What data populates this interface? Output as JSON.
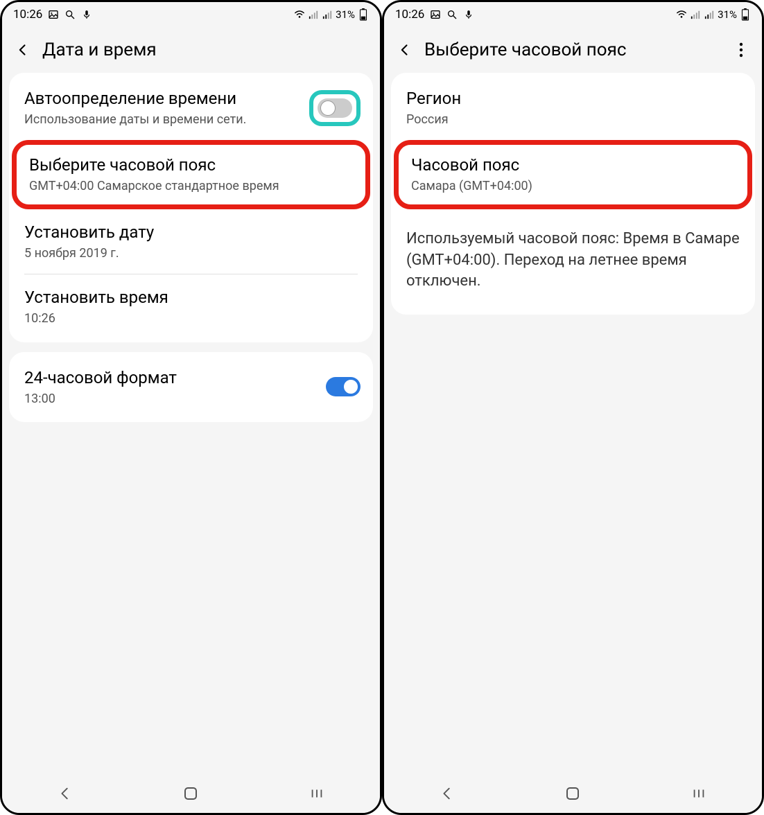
{
  "status": {
    "time": "10:26",
    "battery_pct": "31%"
  },
  "left": {
    "title": "Дата и время",
    "auto": {
      "title": "Автоопределение времени",
      "sub": "Использование даты и времени сети."
    },
    "tz": {
      "title": "Выберите часовой пояс",
      "sub": "GMT+04:00 Самарское стандартное время"
    },
    "date": {
      "title": "Установить дату",
      "sub": "5 ноября 2019 г."
    },
    "time": {
      "title": "Установить время",
      "sub": "10:26"
    },
    "fmt24": {
      "title": "24-часовой формат",
      "sub": "13:00"
    }
  },
  "right": {
    "title": "Выберите часовой пояс",
    "region": {
      "title": "Регион",
      "sub": "Россия"
    },
    "tz": {
      "title": "Часовой пояс",
      "sub": "Самара (GMT+04:00)"
    },
    "info": "Используемый часовой пояс: Время в Самаре (GMT+04:00). Переход на летнее время отключен."
  }
}
